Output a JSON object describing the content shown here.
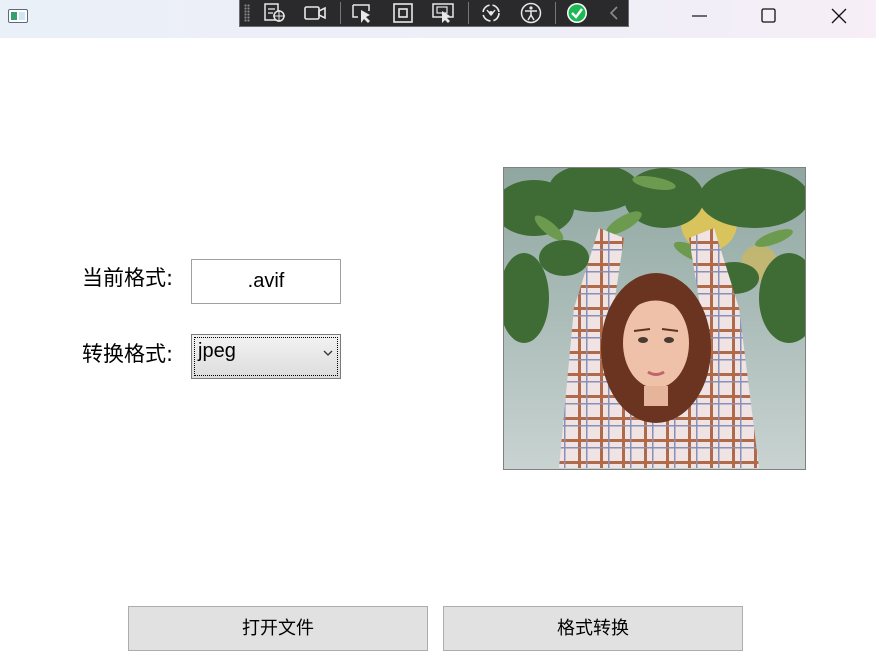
{
  "window": {
    "controls": {
      "minimize": "minimize",
      "maximize": "maximize",
      "close": "close"
    }
  },
  "devtools_toolbar": {
    "tools": [
      "live-visual-tree-icon",
      "record-icon",
      "select-element-icon",
      "display-layout-adorners-icon",
      "track-focus-icon",
      "hot-reload-icon",
      "accessibility-icon",
      "binding-check-icon",
      "collapse-icon"
    ]
  },
  "form": {
    "current_format_label": "当前格式:",
    "current_format_value": ".avif",
    "convert_format_label": "转换格式:",
    "convert_format_value": "jpeg"
  },
  "preview": {
    "subject": "portrait photo of a woman with arms raised under olive branches"
  },
  "buttons": {
    "open_file": "打开文件",
    "convert": "格式转换"
  },
  "colors": {
    "titlebar": "#eef0f8",
    "devbar": "#2a2a2c",
    "button_bg": "#e1e1e1",
    "check_green": "#1db954"
  }
}
